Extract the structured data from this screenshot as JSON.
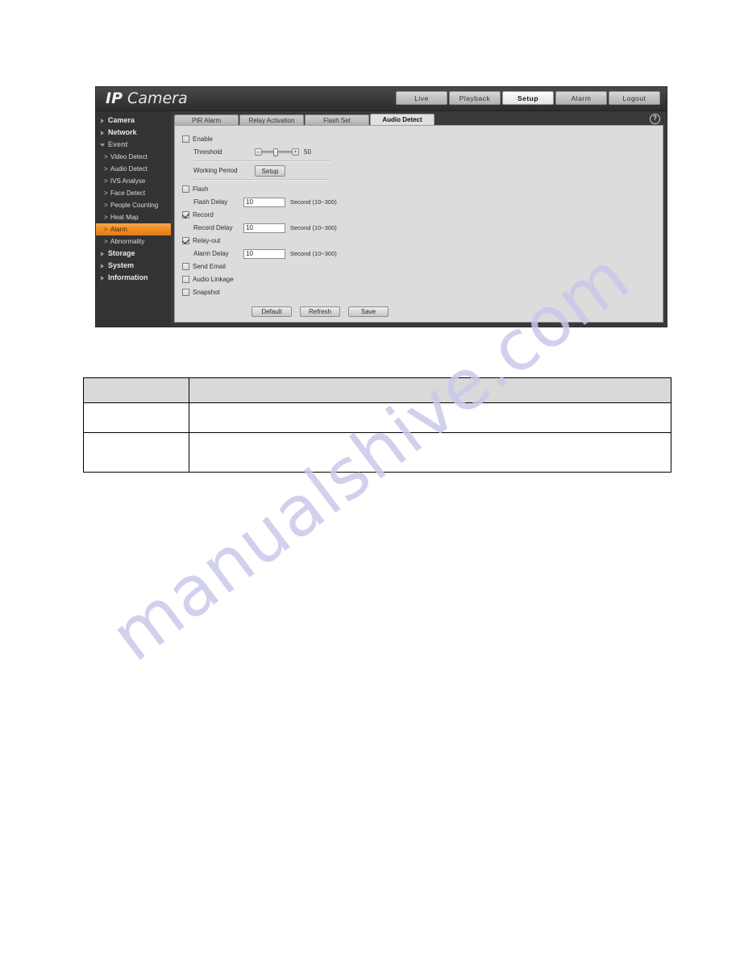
{
  "watermark": {
    "text": "manualshive.com"
  },
  "app": {
    "logo_primary": "IP",
    "logo_secondary": "Camera"
  },
  "topnav": {
    "items": [
      {
        "label": "Live",
        "active": false
      },
      {
        "label": "Playback",
        "active": false
      },
      {
        "label": "Setup",
        "active": true
      },
      {
        "label": "Alarm",
        "active": false
      },
      {
        "label": "Logout",
        "active": false
      }
    ]
  },
  "sidebar": {
    "items": [
      {
        "label": "Camera",
        "level": 1
      },
      {
        "label": "Network",
        "level": 1
      },
      {
        "label": "Event",
        "level": 1
      },
      {
        "label": "Video Detect",
        "level": 2
      },
      {
        "label": "Audio Detect",
        "level": 2
      },
      {
        "label": "IVS Analyse",
        "level": 2
      },
      {
        "label": "Face Detect",
        "level": 2
      },
      {
        "label": "People Counting",
        "level": 2
      },
      {
        "label": "Heat Map",
        "level": 2
      },
      {
        "label": "Alarm",
        "level": 2
      },
      {
        "label": "Abnormality",
        "level": 2
      },
      {
        "label": "Storage",
        "level": 1
      },
      {
        "label": "System",
        "level": 1
      },
      {
        "label": "Information",
        "level": 1
      }
    ],
    "chevron": ">"
  },
  "tabs": [
    {
      "label": "PIR Alarm"
    },
    {
      "label": "Relay Activation"
    },
    {
      "label": "Flash Set"
    },
    {
      "label": "Audio Detect"
    }
  ],
  "help": {
    "glyph": "?"
  },
  "form": {
    "enable": {
      "label": "Enable",
      "checked": false
    },
    "threshold": {
      "label": "Threshold",
      "minus": "–",
      "plus": "+",
      "value": "50"
    },
    "working_period": {
      "label": "Working Period",
      "button": "Setup"
    },
    "flash": {
      "label": "Flash",
      "checked": false
    },
    "flash_delay": {
      "label": "Flash Delay",
      "value": "10",
      "unit": "Second (10~300)"
    },
    "record": {
      "label": "Record",
      "checked": true
    },
    "record_delay": {
      "label": "Record Delay",
      "value": "10",
      "unit": "Second (10~300)"
    },
    "relay_out": {
      "label": "Relay-out",
      "checked": true
    },
    "alarm_delay": {
      "label": "Alarm Delay",
      "value": "10",
      "unit": "Second (10~300)"
    },
    "send_email": {
      "label": "Send Email",
      "checked": false
    },
    "audio_linkage": {
      "label": "Audio Linkage",
      "checked": false
    },
    "snapshot": {
      "label": "Snapshot",
      "checked": false
    },
    "buttons": {
      "default": "Default",
      "refresh": "Refresh",
      "save": "Save"
    }
  },
  "doc_table": {
    "header": [
      "",
      ""
    ],
    "rows": [
      [
        "",
        ""
      ],
      [
        "",
        ""
      ]
    ]
  },
  "colors": {
    "accent": "#ef8d26",
    "sidebar_bg": "#333333",
    "panel_bg": "#dcdcdc",
    "watermark": "#c9c9ea"
  }
}
